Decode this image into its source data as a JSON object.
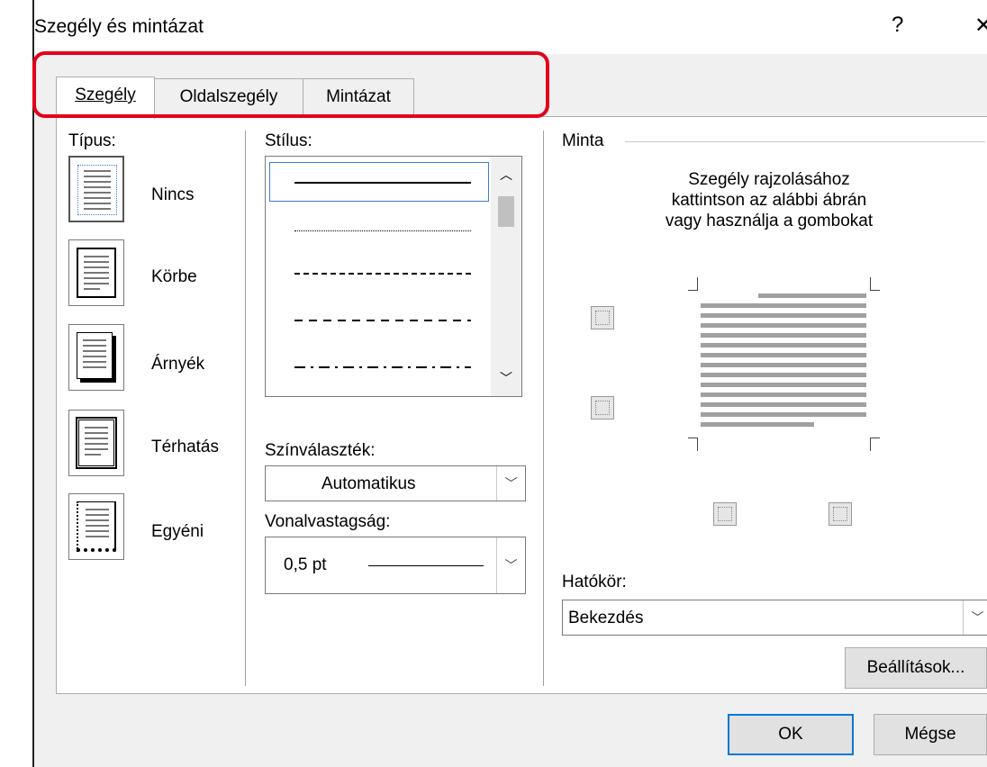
{
  "window": {
    "title": "Szegély és mintázat",
    "help_glyph": "?",
    "close_glyph": "✕"
  },
  "tabs": [
    {
      "label": "Szegély",
      "active": true
    },
    {
      "label": "Oldalszegély",
      "active": false
    },
    {
      "label": "Mintázat",
      "active": false
    }
  ],
  "type_section": {
    "label": "Típus:",
    "items": [
      {
        "label": "Nincs",
        "selected": true
      },
      {
        "label": "Körbe",
        "selected": false
      },
      {
        "label": "Árnyék",
        "selected": false
      },
      {
        "label": "Térhatás",
        "selected": false
      },
      {
        "label": "Egyéni",
        "selected": false
      }
    ]
  },
  "style_section": {
    "label": "Stílus:",
    "styles": [
      "solid",
      "dotted",
      "dashed-fine",
      "dashed",
      "dash-dot"
    ],
    "color_label": "Színválaszték:",
    "color_value": "Automatikus",
    "width_label": "Vonalvastagság:",
    "width_value": "0,5 pt"
  },
  "preview": {
    "label": "Minta",
    "instructions": [
      "Szegély rajzolásához",
      "kattintson az alábbi ábrán",
      "vagy használja a gombokat"
    ],
    "scope_label": "Hatókör:",
    "scope_value": "Bekezdés",
    "options_button": "Beállítások..."
  },
  "footer": {
    "ok": "OK",
    "cancel": "Mégse"
  },
  "colors": {
    "highlight": "#e3001b",
    "accent": "#0078d7"
  }
}
